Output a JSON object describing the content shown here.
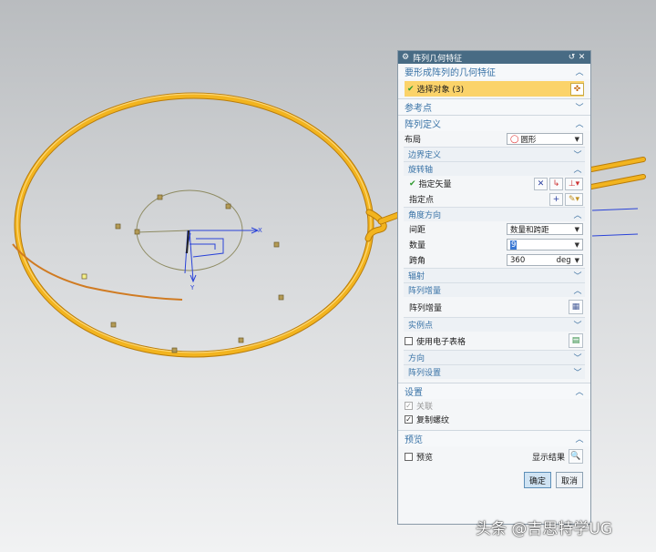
{
  "dialog": {
    "title": "阵列几何特征",
    "section_geometry": {
      "label": "要形成阵列的几何特征",
      "select_label": "选择对象 (3)"
    },
    "section_reference": {
      "label": "参考点"
    },
    "section_definition": {
      "label": "阵列定义",
      "layout_label": "布局",
      "layout_value": "圆形",
      "boundary_label": "边界定义",
      "rotation_axis_label": "旋转轴",
      "specify_vector_label": "指定矢量",
      "specify_point_label": "指定点",
      "angle_direction_label": "角度方向",
      "spacing_label": "间距",
      "spacing_value": "数量和跨距",
      "count_label": "数量",
      "count_value": "9",
      "span_label": "跨角",
      "span_value": "360",
      "span_unit": "deg",
      "radiation_label": "辐射",
      "increment_head_label": "阵列增量",
      "increment_label": "阵列增量",
      "instance_points_label": "实例点",
      "use_spreadsheet_label": "使用电子表格",
      "direction_label": "方向",
      "pattern_settings_label": "阵列设置"
    },
    "section_settings": {
      "label": "设置",
      "associative_label": "关联",
      "associative_checked": true,
      "associative_disabled": true,
      "copy_threads_label": "复制螺纹",
      "copy_threads_checked": true
    },
    "section_preview": {
      "label": "预览",
      "preview_label": "预览",
      "preview_checked": false,
      "show_result_label": "显示结果"
    },
    "ok_label": "确定",
    "cancel_label": "取消"
  },
  "viewport": {
    "axis_x_label": "X",
    "axis_y_label": "Y",
    "part_color": "#f2b41f",
    "axis_color": "#2a43d8"
  },
  "watermark": "头条 @吉思特学UG",
  "colors": {
    "title_bar": "#486b84",
    "section_text": "#3872a6",
    "highlight": "#fbd36a"
  }
}
